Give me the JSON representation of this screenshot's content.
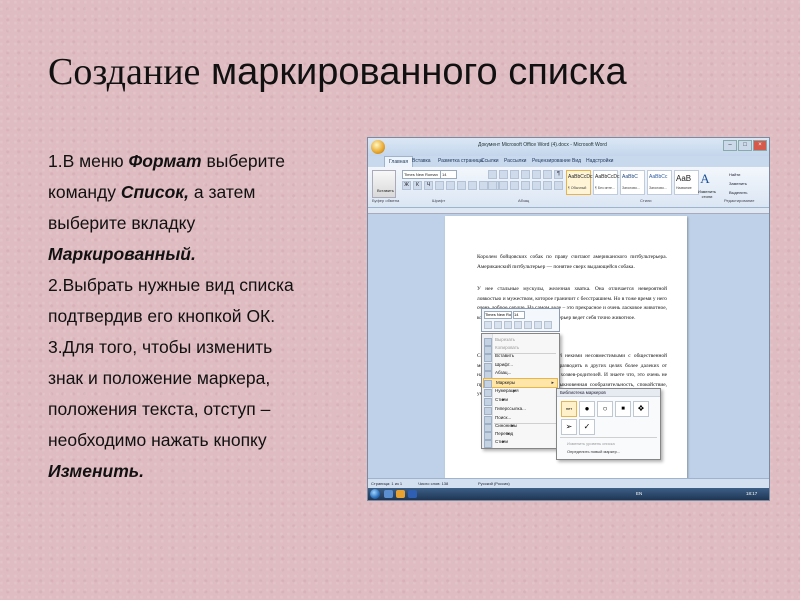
{
  "slide": {
    "title_word1": "Создание",
    "title_rest": "маркированного списка",
    "lines": [
      [
        {
          "t": "1.В меню "
        },
        {
          "t": "Формат",
          "bi": true
        },
        {
          "t": " выберите"
        }
      ],
      [
        {
          "t": " команду "
        },
        {
          "t": "Список,",
          "bi": true
        },
        {
          "t": " а затем"
        }
      ],
      [
        {
          "t": " выберите вкладку"
        }
      ],
      [
        {
          "t": " "
        },
        {
          "t": "Маркированный.",
          "bi": true
        }
      ],
      [
        {
          "t": "2.Выбрать нужные вид списка"
        }
      ],
      [
        {
          "t": "подтвердив его кнопкой ОК."
        }
      ],
      [
        {
          "t": "3.Для того, чтобы изменить"
        }
      ],
      [
        {
          "t": "знак и положение маркера,"
        }
      ],
      [
        {
          "t": "положения текста, отступ –"
        }
      ],
      [
        {
          "t": "необходимо нажать кнопку"
        }
      ],
      [
        {
          "t": "Изменить.",
          "bi": true
        }
      ]
    ]
  },
  "word": {
    "window_title": "Документ Microsoft Office Word (4).docx - Microsoft Word",
    "tabs": [
      "Главная",
      "Вставка",
      "Разметка страницы",
      "Ссылки",
      "Рассылки",
      "Рецензирование",
      "Вид",
      "Надстройки"
    ],
    "paste_label": "Вставить",
    "font_name": "Times New Roman",
    "font_size": "14",
    "group_labels": [
      "Буфер обмена",
      "Шрифт",
      "Абзац",
      "Стили",
      "Редактирование"
    ],
    "styles": [
      {
        "sample": "AaBbCcDc",
        "name": "¶ Обычный"
      },
      {
        "sample": "AaBbCcDc",
        "name": "¶ Без инте..."
      },
      {
        "sample": "AaBbC",
        "name": "Заголово..."
      },
      {
        "sample": "AaBbCc",
        "name": "Заголово..."
      },
      {
        "sample": "AaB",
        "name": "Название"
      }
    ],
    "change_styles_label": "Изменить стили",
    "edit_buttons": [
      "Найти",
      "Заменить",
      "Выделить"
    ],
    "doc_paragraphs": [
      "Королем бойцовских собак по праву считают американского питбультерьера. Американский питбультерьер — понятие сверх выдающейся собака.",
      "У нее стальные мускулы, железная хватка. Она отличается невероятной ловкостью и мужеством, которое граничит с бесстрашием. Но в тоже время у него очень доброе сердце. На самом деле – это прекрасное и очень ласковое животное, которое предано человеку питбультерьер ведет себя точно животное.",
      "Сегодня многие считают питбулей некими несовместимыми с общественной моралью, однако они запрещены разводить в других целях более далеких от насилия, и их просто любят своих хозяев-родителей. И знаете что, это очень не простая задача. Им присуща необыкновенная сообразительность, спокойствие, умение вести себя хорошо."
    ],
    "context_menu": [
      {
        "label": "Вырезать",
        "disabled": true
      },
      {
        "label": "Копировать",
        "disabled": true
      },
      {
        "label": "Вставить"
      },
      {
        "label": "Шрифт..."
      },
      {
        "label": "Абзац..."
      },
      {
        "label": "Маркеры",
        "highlight": true,
        "sub": true
      },
      {
        "label": "Нумерация",
        "sub": true
      },
      {
        "label": "Стили",
        "sub": true
      },
      {
        "label": "Гиперссылка..."
      },
      {
        "label": "Поиск..."
      },
      {
        "label": "Синонимы",
        "sub": true
      },
      {
        "label": "Перевод",
        "sub": true
      },
      {
        "label": "Стили",
        "sub": true
      }
    ],
    "bullet_library_title": "Библиотека маркеров",
    "bullet_none": "нет",
    "bullet_symbols": [
      "●",
      "○",
      "■",
      "❖",
      "➢",
      "✓"
    ],
    "bullet_footer": [
      "Изменить уровень списка",
      "Определить новый маркер..."
    ],
    "status_page": "Страница: 1 из 1",
    "status_words": "Число слов: 138",
    "status_lang": "Русский (Россия)",
    "tray_lang": "EN",
    "tray_time": "18:17"
  }
}
